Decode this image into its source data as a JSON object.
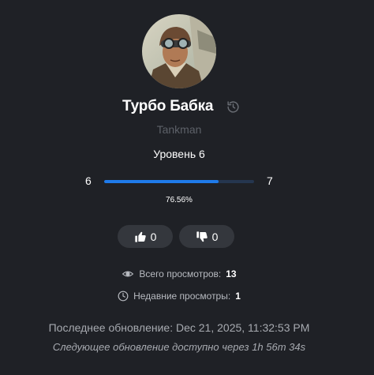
{
  "profile": {
    "name": "Турбо Бабка",
    "subtitle": "Tankman",
    "avatar_icon": "pilot-avatar",
    "history_icon": "history-icon"
  },
  "level": {
    "label": "Уровень 6",
    "current": "6",
    "next": "7",
    "progress_text": "76.56%",
    "progress_fraction": 0.7656
  },
  "votes": {
    "likes": "0",
    "dislikes": "0",
    "like_icon": "thumbs-up-icon",
    "dislike_icon": "thumbs-down-icon"
  },
  "stats": {
    "total_views_label": "Всего просмотров:",
    "total_views_value": "13",
    "recent_views_label": "Недавние просмотры:",
    "recent_views_value": "1"
  },
  "updates": {
    "last_update": "Последнее обновление: Dec 21, 2025, 11:32:53 PM",
    "next_update": "Следующее обновление доступно через 1h 56m 34s"
  },
  "colors": {
    "background": "#1f2126",
    "accent": "#1f7bea",
    "track": "#25364f",
    "button_bg": "#34373d",
    "muted": "#5d6168"
  }
}
